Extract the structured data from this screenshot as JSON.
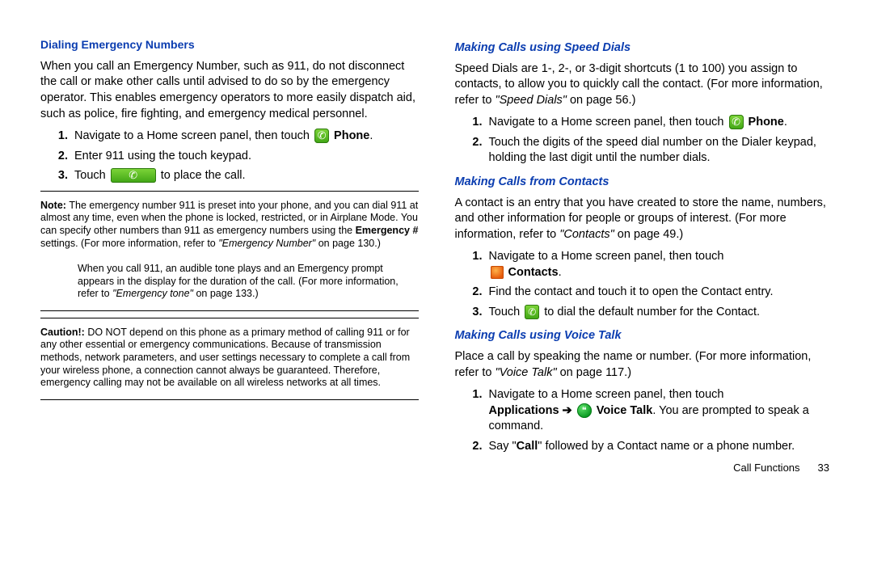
{
  "left": {
    "h1": "Dialing Emergency Numbers",
    "intro": "When you call an Emergency Number, such as 911, do not disconnect the call or make other calls until advised to do so by the emergency operator. This enables emergency operators to more easily dispatch aid, such as police, fire fighting, and emergency medical personnel.",
    "step1a": "Navigate to a Home screen panel, then touch ",
    "step1b": "Phone",
    "step1c": ".",
    "step2": "Enter 911 using the touch keypad.",
    "step3a": "Touch ",
    "step3b": " to place the call.",
    "note_label": "Note: ",
    "note1a": "The emergency number 911 is preset into your phone, and you can dial 911 at almost any time, even when the phone is locked, restricted, or in Airplane Mode. You can specify other numbers than 911 as emergency numbers using the ",
    "note1b": "Emergency #",
    "note1c": " settings. (For more information, refer to ",
    "note1d": "\"Emergency Number\"",
    "note1e": " on page 130.)",
    "note2a": "When you call 911, an audible tone plays and an Emergency prompt appears in the display for the duration of the call. (For more information, refer to ",
    "note2b": "\"Emergency tone\"",
    "note2c": " on page 133.)",
    "caution_label": "Caution!: ",
    "caution": "DO NOT depend on this phone as a primary method of calling 911 or for any other essential or emergency communications. Because of transmission methods, network parameters, and user settings necessary to complete a call from your wireless phone, a connection cannot always be guaranteed. Therefore, emergency calling may not be available on all wireless networks at all times."
  },
  "right": {
    "h1": "Making Calls using Speed Dials",
    "p1a": "Speed Dials are 1-, 2-, or 3-digit shortcuts (1 to 100) you assign to contacts, to allow you to quickly call the contact. (For more information, refer to ",
    "p1b": "\"Speed Dials\"",
    "p1c": " on page 56.)",
    "sd_step1a": "Navigate to a Home screen panel, then touch ",
    "sd_step1b": "Phone",
    "sd_step1c": ".",
    "sd_step2": "Touch the digits of the speed dial number on the Dialer keypad, holding the last digit until the number dials.",
    "h2": "Making Calls from Contacts",
    "p2a": "A contact is an entry that you have created to store the name, numbers, and other information for people or groups of interest. (For more information, refer to ",
    "p2b": "\"Contacts\"",
    "p2c": " on page 49.)",
    "c_step1a": "Navigate to a Home screen panel, then touch",
    "c_step1b": "Contacts",
    "c_step1c": ".",
    "c_step2": "Find the contact and touch it to open the Contact entry.",
    "c_step3a": "Touch ",
    "c_step3b": " to dial the default number for the Contact.",
    "h3": "Making Calls using Voice Talk",
    "p3a": "Place a call by speaking the name or number. (For more information, refer to ",
    "p3b": "\"Voice Talk\"",
    "p3c": " on page 117.)",
    "v_step1a": "Navigate to a Home screen panel, then touch ",
    "v_step1b": "Applications ➔",
    "v_step1c": "Voice Talk",
    "v_step1d": ". You are prompted to speak a command.",
    "v_step2a": "Say \"",
    "v_step2b": "Call",
    "v_step2c": "\" followed by a Contact name or a phone number."
  },
  "footer": {
    "label": "Call Functions",
    "page": "33"
  }
}
